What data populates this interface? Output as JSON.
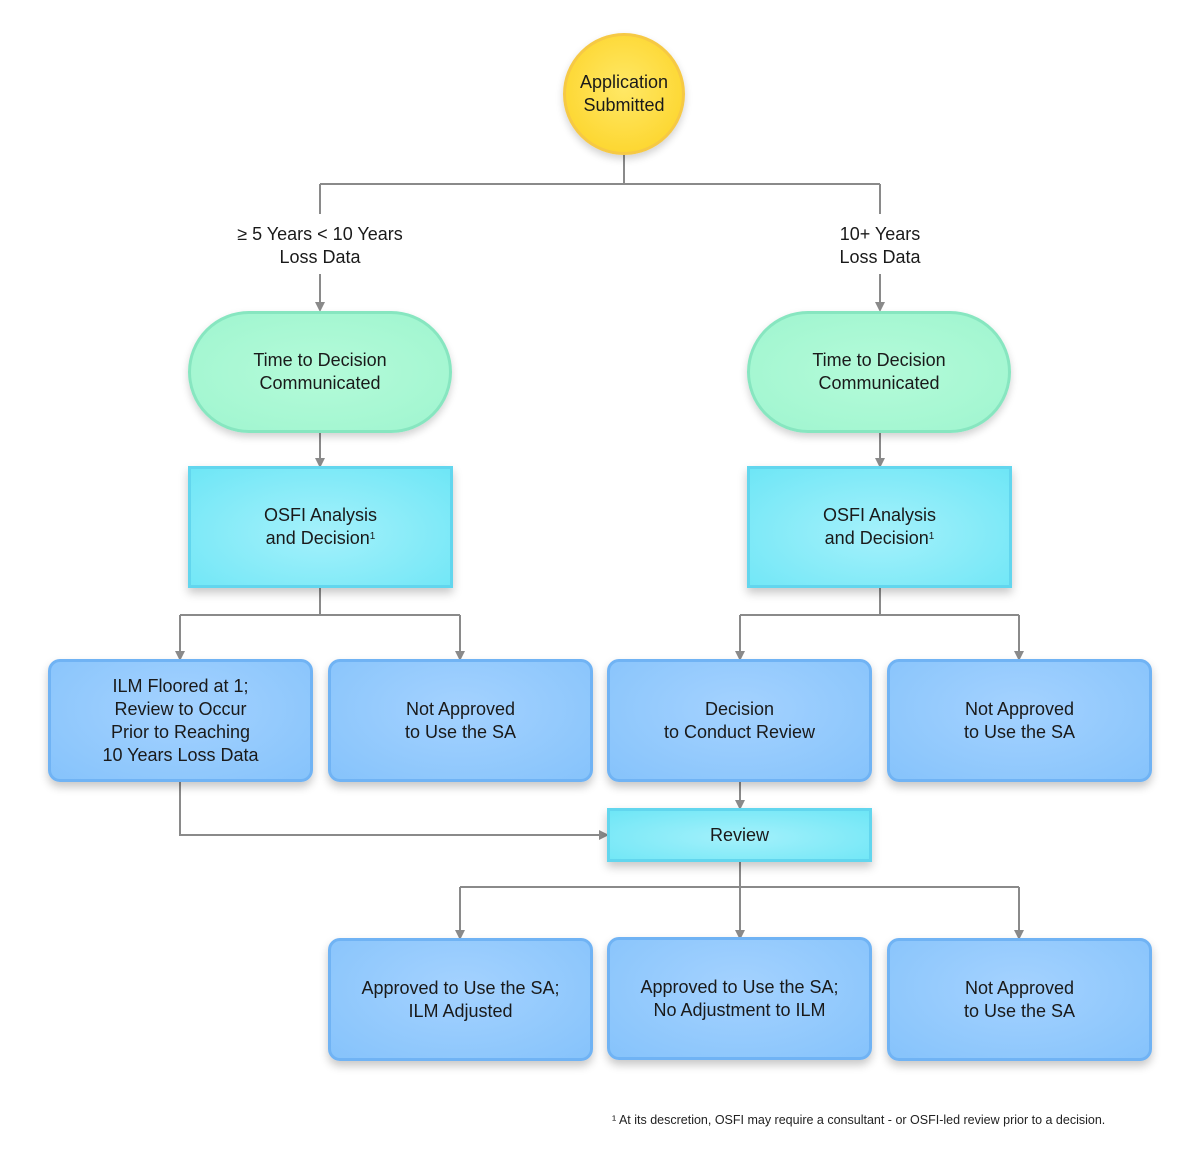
{
  "diagram": {
    "start": {
      "label": "Application\nSubmitted",
      "color": "#fdd835"
    },
    "branches": [
      {
        "condition": "≥ 5 Years < 10 Years\nLoss Data",
        "time_to_decision": "Time to Decision\nCommunicated",
        "analysis": {
          "label": "OSFI Analysis\nand Decision",
          "footnote_ref": "1"
        },
        "outcomes": [
          "ILM Floored at 1;\nReview to Occur\nPrior to Reaching\n10 Years Loss Data",
          "Not Approved\nto Use the SA"
        ]
      },
      {
        "condition": "10+ Years\nLoss Data",
        "time_to_decision": "Time to Decision\nCommunicated",
        "analysis": {
          "label": "OSFI Analysis\nand Decision",
          "footnote_ref": "1"
        },
        "outcomes": [
          "Decision\nto Conduct Review",
          "Not Approved\nto Use the SA"
        ]
      }
    ],
    "review": {
      "label": "Review"
    },
    "review_outcomes": [
      "Approved to Use the SA;\nILM Adjusted",
      "Approved to Use the SA;\nNo Adjustment to ILM",
      "Not Approved\nto Use the SA"
    ],
    "footnote": "¹ At its descretion, OSFI may require a consultant - or OSFI-led review prior to a decision.",
    "colors": {
      "connector": "#8a8a8a",
      "start": "#fdd835",
      "time_to_decision": "#a6f7d2",
      "analysis": "#7ee9f8",
      "outcome": "#93c9fd"
    }
  }
}
